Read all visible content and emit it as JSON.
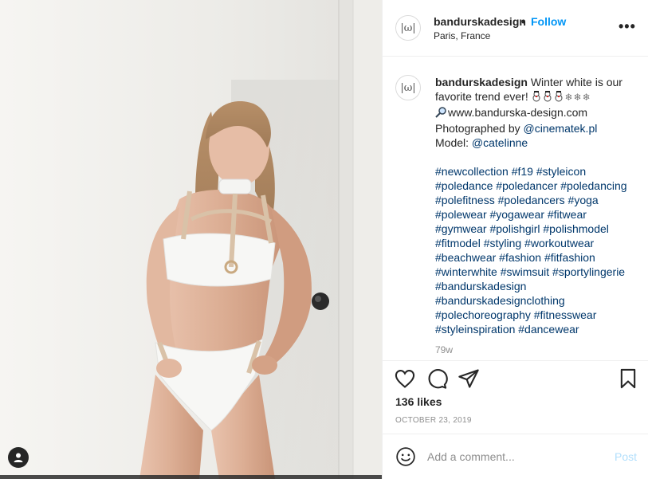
{
  "post": {
    "photo_alt": "Model in white bikini with beige harness straps leaning against a white wall"
  },
  "header": {
    "username": "bandurskadesign",
    "separator": "•",
    "follow_label": "Follow",
    "location": "Paris, France",
    "more_label": "•••",
    "avatar_glyph": "|ω|"
  },
  "caption": {
    "username": "bandurskadesign",
    "text_intro": "Winter white is our favorite trend ever!",
    "snowflakes": "❄❄❄",
    "website": "www.bandurska-design.com",
    "photographed_by_label": "Photographed by",
    "photographer": "@cinematek.pl",
    "model_label": "Model:",
    "model": "@catelinne",
    "hashtag_lines": [
      "#newcollection #f19 #styleicon",
      "#poledance #poledancer #poledancing",
      "#polefitness #poledancers #yoga",
      "#polewear #yogawear #fitwear",
      "#gymwear #polishgirl #polishmodel",
      "#fitmodel #styling #workoutwear",
      "#beachwear #fashion #fitfashion",
      "#winterwhite #swimsuit #sportylingerie",
      "#bandurskadesign",
      "#bandurskadesignclothing",
      "#polechoreography #fitnesswear",
      "#styleinspiration #dancewear"
    ],
    "time_ago": "79w"
  },
  "stats": {
    "likes": "136 likes",
    "date": "OCTOBER 23, 2019"
  },
  "comment_box": {
    "placeholder": "Add a comment...",
    "post_label": "Post"
  },
  "colors": {
    "accent": "#0095f6",
    "link": "#00376b",
    "muted": "#8e8e8e",
    "post_disabled": "#b2dffc"
  }
}
